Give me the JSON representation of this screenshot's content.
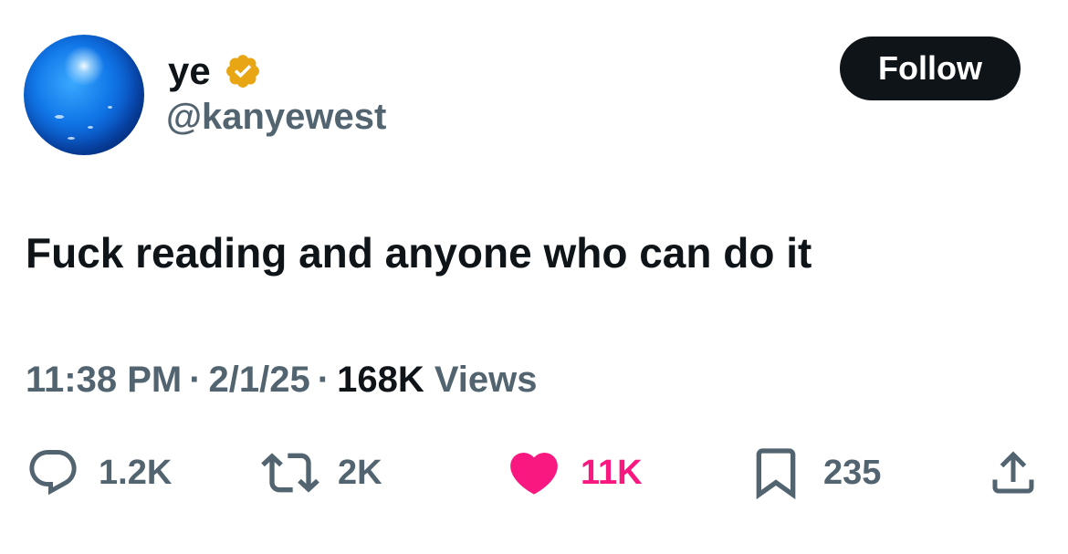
{
  "user": {
    "display_name": "ye",
    "handle": "@kanyewest",
    "verified_color": "#e8a514",
    "avatar_icon": "blue-sphere-avatar"
  },
  "follow_button": {
    "label": "Follow"
  },
  "tweet": {
    "text": "Fuck reading and anyone who can do it",
    "time": "11:38 PM",
    "date": "2/1/25",
    "views_count": "168K",
    "views_label": "Views"
  },
  "actions": {
    "reply": {
      "icon": "reply-icon",
      "count": "1.2K"
    },
    "retweet": {
      "icon": "retweet-icon",
      "count": "2K"
    },
    "like": {
      "icon": "heart-icon",
      "count": "11K",
      "color": "#f91880",
      "active": true
    },
    "bookmark": {
      "icon": "bookmark-icon",
      "count": "235"
    },
    "share": {
      "icon": "share-icon"
    }
  },
  "colors": {
    "text_primary": "#0f1419",
    "text_secondary": "#536471",
    "like_pink": "#f91880",
    "follow_bg": "#0f1419"
  }
}
